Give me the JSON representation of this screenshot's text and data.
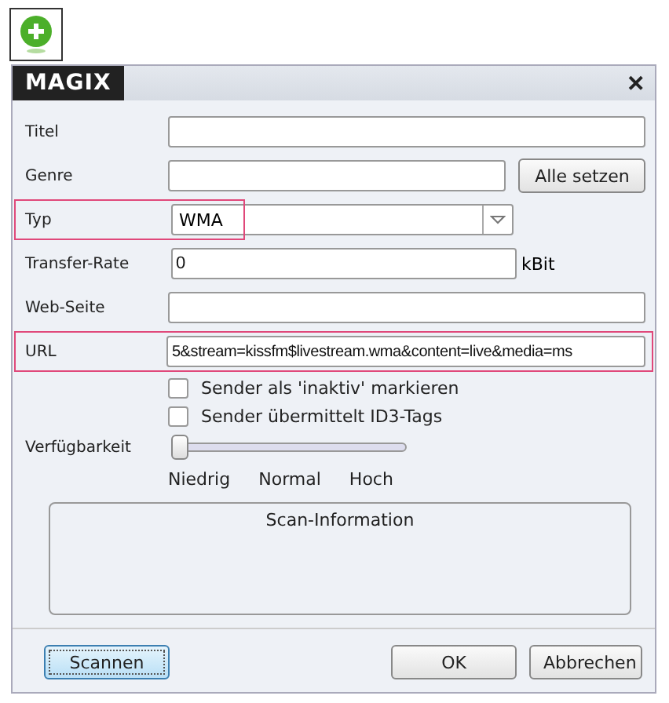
{
  "window": {
    "title": "MAGIX",
    "close": "✕"
  },
  "fields": [
    {
      "label": "Titel",
      "kind": "text",
      "highlighted": false
    },
    {
      "label": "Genre",
      "kind": "text-button",
      "button": "Alle setzen",
      "highlighted": false
    },
    {
      "label": "Typ",
      "kind": "select",
      "value": "WMA",
      "highlighted": true
    },
    {
      "label": "Transfer-Rate",
      "kind": "text-unit",
      "value": "0",
      "unit": "kBit",
      "highlighted": false
    },
    {
      "label": "Web-Seite",
      "kind": "text",
      "highlighted": false
    },
    {
      "label": "URL",
      "kind": "text",
      "value": "5&stream=kissfm$livestream.wma&content=live&media=ms",
      "highlighted": true
    }
  ],
  "checkboxes": [
    {
      "label": "Sender als 'inaktiv' markieren",
      "checked": false
    },
    {
      "label": "Sender übermittelt ID3-Tags",
      "checked": false
    }
  ],
  "availability": {
    "label": "Verfügbarkeit",
    "level": 0,
    "ticks": [
      "Niedrig",
      "Normal",
      "Hoch"
    ]
  },
  "scan_info": {
    "title": "Scan-Information"
  },
  "buttons": [
    {
      "label": "Scannen",
      "kind": "primary"
    },
    {
      "label": "OK",
      "kind": "normal"
    },
    {
      "label": "Abbrechen",
      "kind": "normal"
    }
  ]
}
